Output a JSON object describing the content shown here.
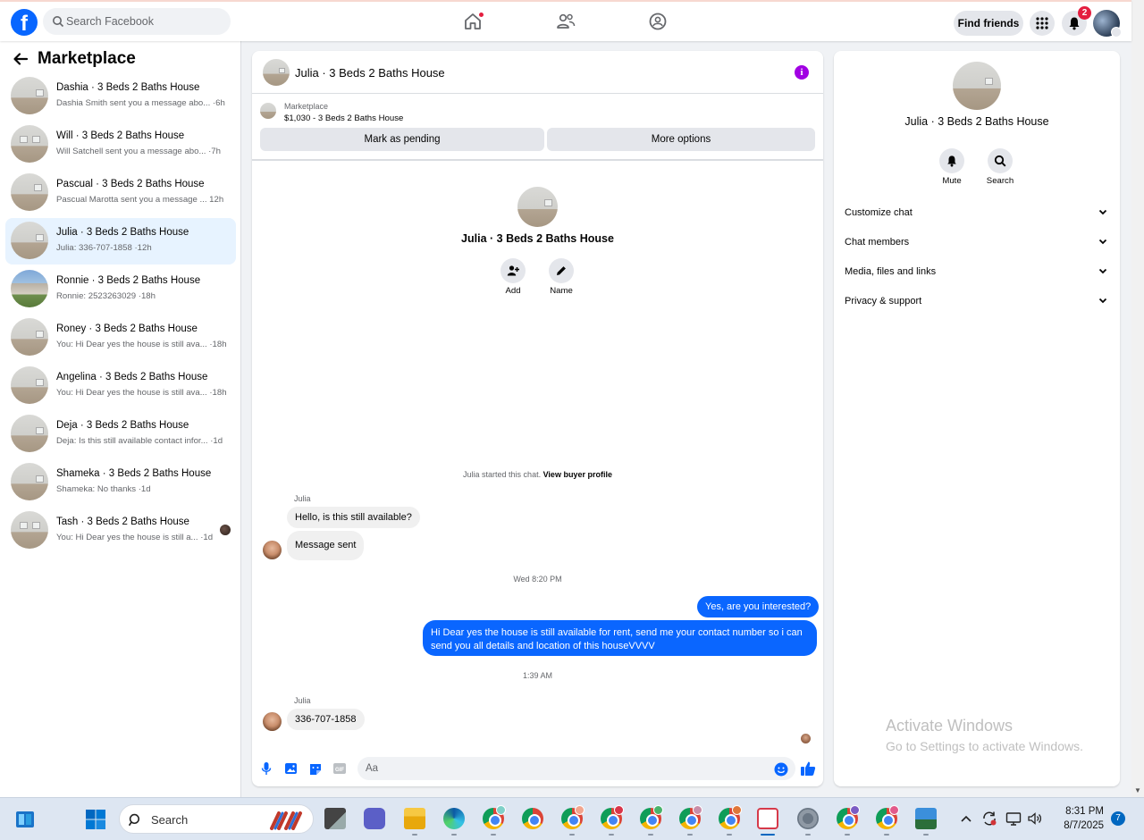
{
  "topbar": {
    "logo_letter": "f",
    "search_placeholder": "Search Facebook",
    "nav_icons": [
      "home-icon",
      "friends-icon",
      "groups-icon"
    ],
    "find_friends_label": "Find friends",
    "notification_count": "2"
  },
  "sidebar": {
    "title": "Marketplace",
    "conversations": [
      {
        "name": "Dashia · 3 Beds 2 Baths House",
        "preview": "Dashia Smith sent you a message abo... ·6h",
        "active": false
      },
      {
        "name": "Will · 3 Beds 2 Baths House",
        "preview": "Will Satchell sent you a message abo... ·7h",
        "active": false
      },
      {
        "name": "Pascual · 3 Beds 2 Baths House",
        "preview": "Pascual Marotta sent you a message ... 12h",
        "active": false
      },
      {
        "name": "Julia · 3 Beds 2 Baths House",
        "preview": "Julia: 336-707-1858 ·12h",
        "active": true
      },
      {
        "name": "Ronnie · 3 Beds 2 Baths House",
        "preview": "Ronnie: 2523263029 ·18h",
        "active": false
      },
      {
        "name": "Roney · 3 Beds 2 Baths House",
        "preview": "You: Hi Dear yes the house is still ava... ·18h",
        "active": false
      },
      {
        "name": "Angelina · 3 Beds 2 Baths House",
        "preview": "You: Hi Dear yes the house is still ava... ·18h",
        "active": false
      },
      {
        "name": "Deja · 3 Beds 2 Baths House",
        "preview": "Deja: Is this still available contact infor... ·1d",
        "active": false
      },
      {
        "name": "Shameka · 3 Beds 2 Baths House",
        "preview": "Shameka: No thanks ·1d",
        "active": false
      },
      {
        "name": "Tash · 3 Beds 2 Baths House",
        "preview": "You: Hi Dear yes the house is still a... ·1d",
        "active": false
      }
    ]
  },
  "chat": {
    "title": "Julia · 3 Beds 2 Baths House",
    "listing": {
      "source": "Marketplace",
      "price_title": "$1,030 - 3 Beds 2 Baths House",
      "mark_pending_label": "Mark as pending",
      "more_options_label": "More options"
    },
    "profile": {
      "name": "Julia · 3 Beds 2 Baths House",
      "actions": [
        "Add",
        "Name"
      ]
    },
    "started_text": "Julia started this chat.",
    "view_buyer_profile": "View buyer profile",
    "messages": {
      "sender1": "Julia",
      "in1": "Hello, is this still available?",
      "in2": "Message sent",
      "timestamp1": "Wed 8:20 PM",
      "out1": "Yes, are you interested?",
      "out2": "Hi Dear yes the house is still available for rent, send me your contact number so i can send you all details and location of this houseVVVV",
      "timestamp2": "1:39 AM",
      "sender2": "Julia",
      "in3": "336-707-1858"
    },
    "composer": {
      "placeholder": "Aa",
      "icons": [
        "microphone-icon",
        "photo-icon",
        "sticker-icon",
        "gif-icon",
        "emoji-icon",
        "like-icon"
      ]
    }
  },
  "details": {
    "name": "Julia · 3 Beds 2 Baths House",
    "actions": [
      "Mute",
      "Search"
    ],
    "menu": [
      "Customize chat",
      "Chat members",
      "Media, files and links",
      "Privacy & support"
    ]
  },
  "watermark": {
    "line1": "Activate Windows",
    "line2": "Go to Settings to activate Windows."
  },
  "taskbar": {
    "search_label": "Search",
    "time": "8:31 PM",
    "date": "8/7/2025",
    "notification_count": "7"
  },
  "colors": {
    "facebook_blue": "#0866ff",
    "messenger_bubble": "#0a66ff",
    "active_row": "#e7f3ff",
    "info_purple": "#a100e3",
    "badge_red": "#e41e3f"
  }
}
